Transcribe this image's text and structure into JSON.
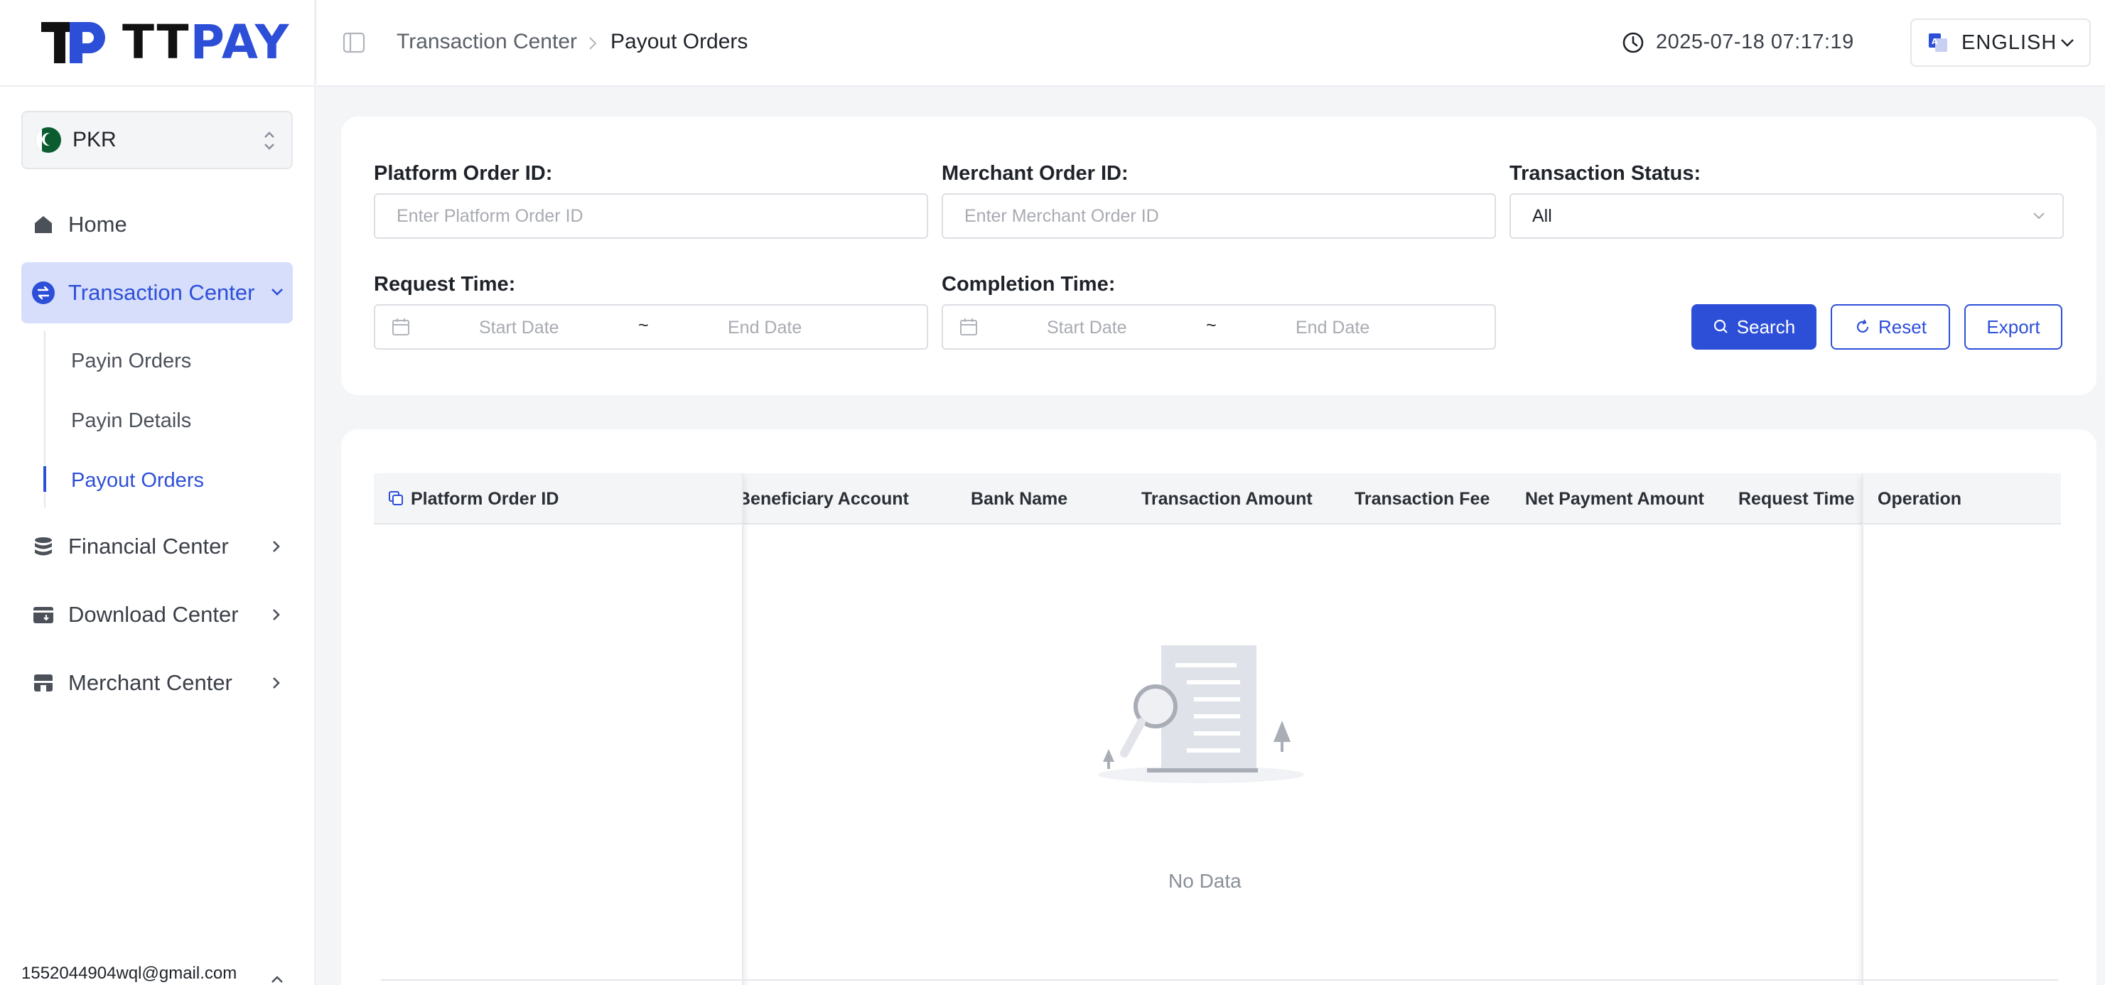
{
  "brand": {
    "logo_text_tt": "TT",
    "logo_text_pay": "PAY",
    "accent": "#2d4fd8"
  },
  "currency": {
    "label": "PKR",
    "icon": "pakistan-flag-icon"
  },
  "nav": {
    "home": "Home",
    "transaction_center": "Transaction Center",
    "sub_items": [
      "Payin Orders",
      "Payin Details",
      "Payout Orders"
    ],
    "financial_center": "Financial Center",
    "download_center": "Download Center",
    "merchant_center": "Merchant Center"
  },
  "user": {
    "email": "1552044904wql@gmail.com"
  },
  "header": {
    "breadcrumb": [
      "Transaction Center",
      "Payout Orders"
    ],
    "datetime": "2025-07-18 07:17:19",
    "language": "ENGLISH"
  },
  "filters": {
    "platform_order_id": {
      "label": "Platform Order ID:",
      "placeholder": "Enter Platform Order ID"
    },
    "merchant_order_id": {
      "label": "Merchant Order ID:",
      "placeholder": "Enter Merchant Order ID"
    },
    "transaction_status": {
      "label": "Transaction Status:",
      "value": "All"
    },
    "request_time": {
      "label": "Request Time:",
      "start": "Start Date",
      "sep": "~",
      "end": "End Date"
    },
    "completion_time": {
      "label": "Completion Time:",
      "start": "Start Date",
      "sep": "~",
      "end": "End Date"
    },
    "buttons": {
      "search": "Search",
      "reset": "Reset",
      "export": "Export"
    }
  },
  "table": {
    "columns": {
      "platform_order_id": "Platform Order ID",
      "beneficiary_account": "Beneficiary Account",
      "bank_name": "Bank Name",
      "transaction_amount": "Transaction Amount",
      "transaction_fee": "Transaction Fee",
      "net_payment_amount": "Net Payment Amount",
      "request_time": "Request Time",
      "operation": "Operation"
    },
    "empty_text": "No Data"
  }
}
